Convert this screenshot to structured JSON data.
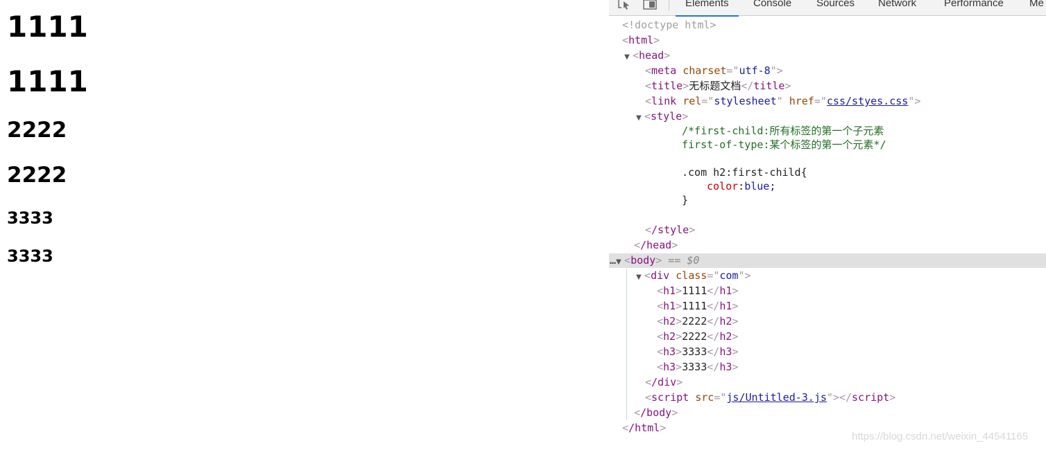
{
  "rendered_page": {
    "h1": [
      "1111",
      "1111"
    ],
    "h2": [
      "2222",
      "2222"
    ],
    "h3": [
      "3333",
      "3333"
    ]
  },
  "devtools": {
    "tabs": [
      "Elements",
      "Console",
      "Sources",
      "Network",
      "Performance",
      "Me"
    ],
    "active_tab": "Elements",
    "dom": {
      "doctype": "<!doctype html>",
      "html_open": "html",
      "head": "head",
      "meta": {
        "tag": "meta",
        "attr": "charset",
        "value": "utf-8"
      },
      "title": {
        "tag": "title",
        "text": "无标题文档"
      },
      "link": {
        "tag": "link",
        "rel_attr": "rel",
        "rel": "stylesheet",
        "href_attr": "href",
        "href": "css/styes.css"
      },
      "style": "style",
      "comment_line1": "/*first-child:所有标签的第一个子元素",
      "comment_line2": "first-of-type:某个标签的第一个元素*/",
      "css_selector": ".com h2:first-child{",
      "css_prop": "color",
      "css_value": "blue",
      "css_close": "}",
      "style_close": "/style",
      "head_close": "/head",
      "body": "body",
      "selected_marker": "== $0",
      "div": {
        "tag": "div",
        "attr": "class",
        "value": "com"
      },
      "children": [
        {
          "tag": "h1",
          "text": "1111"
        },
        {
          "tag": "h1",
          "text": "1111"
        },
        {
          "tag": "h2",
          "text": "2222"
        },
        {
          "tag": "h2",
          "text": "2222"
        },
        {
          "tag": "h3",
          "text": "3333"
        },
        {
          "tag": "h3",
          "text": "3333"
        }
      ],
      "div_close": "/div",
      "script": {
        "tag": "script",
        "attr": "src",
        "value": "js/Untitled-3.js"
      },
      "body_close": "/body",
      "html_close": "/html"
    }
  },
  "watermark": "https://blog.csdn.net/weixin_44541165",
  "colors": {
    "tag": "#881280",
    "attr_name": "#994500",
    "attr_value": "#1a1aa6",
    "comment": "#236e25",
    "active_tab": "#1a73e8"
  }
}
